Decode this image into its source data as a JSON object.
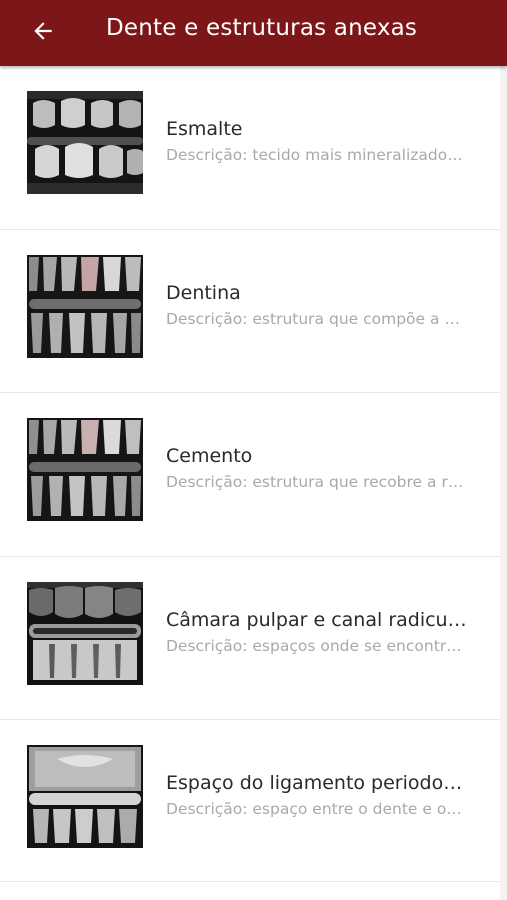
{
  "header": {
    "title": "Dente e estruturas anexas",
    "back_icon": "arrow-left-icon",
    "background": "#7d1618"
  },
  "items": [
    {
      "title": "Esmalte",
      "description": "Descrição: tecido mais mineralizado do corpo humano"
    },
    {
      "title": "Dentina",
      "description": "Descrição: estrutura que compõe a maior parte do dente"
    },
    {
      "title": "Cemento",
      "description": "Descrição: estrutura que recobre a raiz"
    },
    {
      "title": "Câmara pulpar e canal radicular",
      "description": "Descrição: espaços onde se encontra a polpa"
    },
    {
      "title": "Espaço do ligamento periodontal",
      "description": "Descrição: espaço entre o dente e o osso"
    }
  ]
}
